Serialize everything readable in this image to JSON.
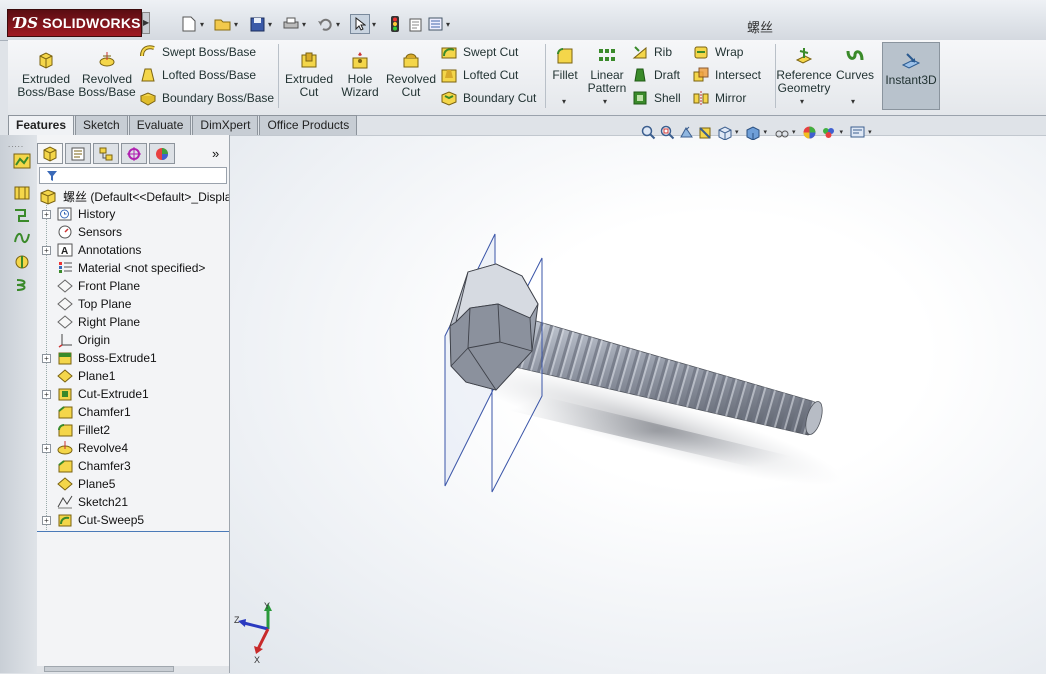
{
  "app": {
    "brand": "SOLIDWORKS",
    "document_title": "螺丝"
  },
  "quick_access": [
    "new-icon",
    "open-icon",
    "save-icon",
    "print-icon",
    "undo-icon",
    "select-icon",
    "rebuild-icon",
    "file-properties-icon",
    "options-icon"
  ],
  "ribbon": {
    "extruded_boss": "Extruded\nBoss/Base",
    "revolved_boss": "Revolved\nBoss/Base",
    "swept_boss": "Swept Boss/Base",
    "lofted_boss": "Lofted Boss/Base",
    "boundary_boss": "Boundary Boss/Base",
    "extruded_cut": "Extruded\nCut",
    "hole_wizard": "Hole\nWizard",
    "revolved_cut": "Revolved\nCut",
    "swept_cut": "Swept Cut",
    "lofted_cut": "Lofted Cut",
    "boundary_cut": "Boundary Cut",
    "fillet": "Fillet",
    "linear_pattern": "Linear\nPattern",
    "rib": "Rib",
    "draft": "Draft",
    "shell": "Shell",
    "wrap": "Wrap",
    "intersect": "Intersect",
    "mirror": "Mirror",
    "reference_geometry": "Reference\nGeometry",
    "curves": "Curves",
    "instant3d": "Instant3D"
  },
  "tabs": [
    "Features",
    "Sketch",
    "Evaluate",
    "DimXpert",
    "Office Products"
  ],
  "active_tab": "Features",
  "tree": {
    "root": "螺丝  (Default<<Default>_Displa",
    "items": [
      {
        "label": "History",
        "icon": "history-icon",
        "expand": true
      },
      {
        "label": "Sensors",
        "icon": "sensors-icon",
        "expand": false
      },
      {
        "label": "Annotations",
        "icon": "annotations-icon",
        "expand": true
      },
      {
        "label": "Material <not specified>",
        "icon": "material-icon",
        "expand": false
      },
      {
        "label": "Front Plane",
        "icon": "plane-icon",
        "expand": false
      },
      {
        "label": "Top Plane",
        "icon": "plane-icon",
        "expand": false
      },
      {
        "label": "Right Plane",
        "icon": "plane-icon",
        "expand": false
      },
      {
        "label": "Origin",
        "icon": "origin-icon",
        "expand": false
      },
      {
        "label": "Boss-Extrude1",
        "icon": "boss-extrude-icon",
        "expand": true
      },
      {
        "label": "Plane1",
        "icon": "plane-feature-icon",
        "expand": false
      },
      {
        "label": "Cut-Extrude1",
        "icon": "cut-extrude-icon",
        "expand": true
      },
      {
        "label": "Chamfer1",
        "icon": "chamfer-icon",
        "expand": false
      },
      {
        "label": "Fillet2",
        "icon": "fillet-icon",
        "expand": false
      },
      {
        "label": "Revolve4",
        "icon": "revolve-icon",
        "expand": true
      },
      {
        "label": "Chamfer3",
        "icon": "chamfer-icon",
        "expand": false
      },
      {
        "label": "Plane5",
        "icon": "plane-feature-icon",
        "expand": false
      },
      {
        "label": "Sketch21",
        "icon": "sketch-icon",
        "expand": false
      },
      {
        "label": "Cut-Sweep5",
        "icon": "cut-sweep-icon",
        "expand": true
      }
    ]
  },
  "triad": {
    "x": "X",
    "y": "Y",
    "z": "Z"
  }
}
